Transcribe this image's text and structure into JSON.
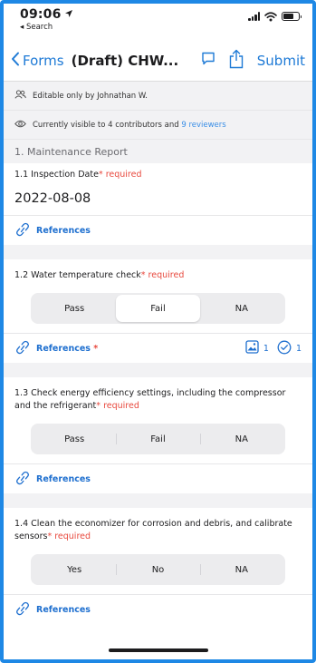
{
  "status_bar": {
    "time": "09:06",
    "back_label": "◂ Search"
  },
  "nav": {
    "back_label": "Forms",
    "title": "(Draft) CHW...",
    "submit_label": "Submit"
  },
  "info": {
    "editable": "Editable only by Johnathan W.",
    "visible_prefix": "Currently visible to 4 contributors and ",
    "visible_link": "9 reviewers"
  },
  "section": {
    "title": "1. Maintenance Report"
  },
  "questions": [
    {
      "title": "1.1 Inspection Date",
      "required_mark": "* required",
      "value": "2022-08-08",
      "refs_label": "References"
    },
    {
      "title": "1.2 Water temperature check",
      "required_mark": "* required",
      "options": [
        "Pass",
        "Fail",
        "NA"
      ],
      "selected": "Fail",
      "refs_label": "References",
      "refs_required": " *",
      "photo_count": "1",
      "check_count": "1"
    },
    {
      "title": "1.3 Check energy efficiency settings, including the compressor and the refrigerant",
      "required_mark": "* required",
      "options": [
        "Pass",
        "Fail",
        "NA"
      ],
      "selected": "",
      "refs_label": "References"
    },
    {
      "title": "1.4 Clean the economizer for corrosion and debris, and calibrate sensors",
      "required_mark": "* required",
      "options": [
        "Yes",
        "No",
        "NA"
      ],
      "selected": "",
      "refs_label": "References"
    }
  ],
  "colors": {
    "accent": "#1e7ad6",
    "required": "#e8493e",
    "frame": "#1e88e5"
  },
  "icons": [
    "location-arrow-icon",
    "signal-icon",
    "wifi-icon",
    "battery-icon",
    "chevron-left-icon",
    "comment-icon",
    "share-icon",
    "people-icon",
    "eye-icon",
    "link-icon",
    "image-icon",
    "check-circle-icon"
  ]
}
